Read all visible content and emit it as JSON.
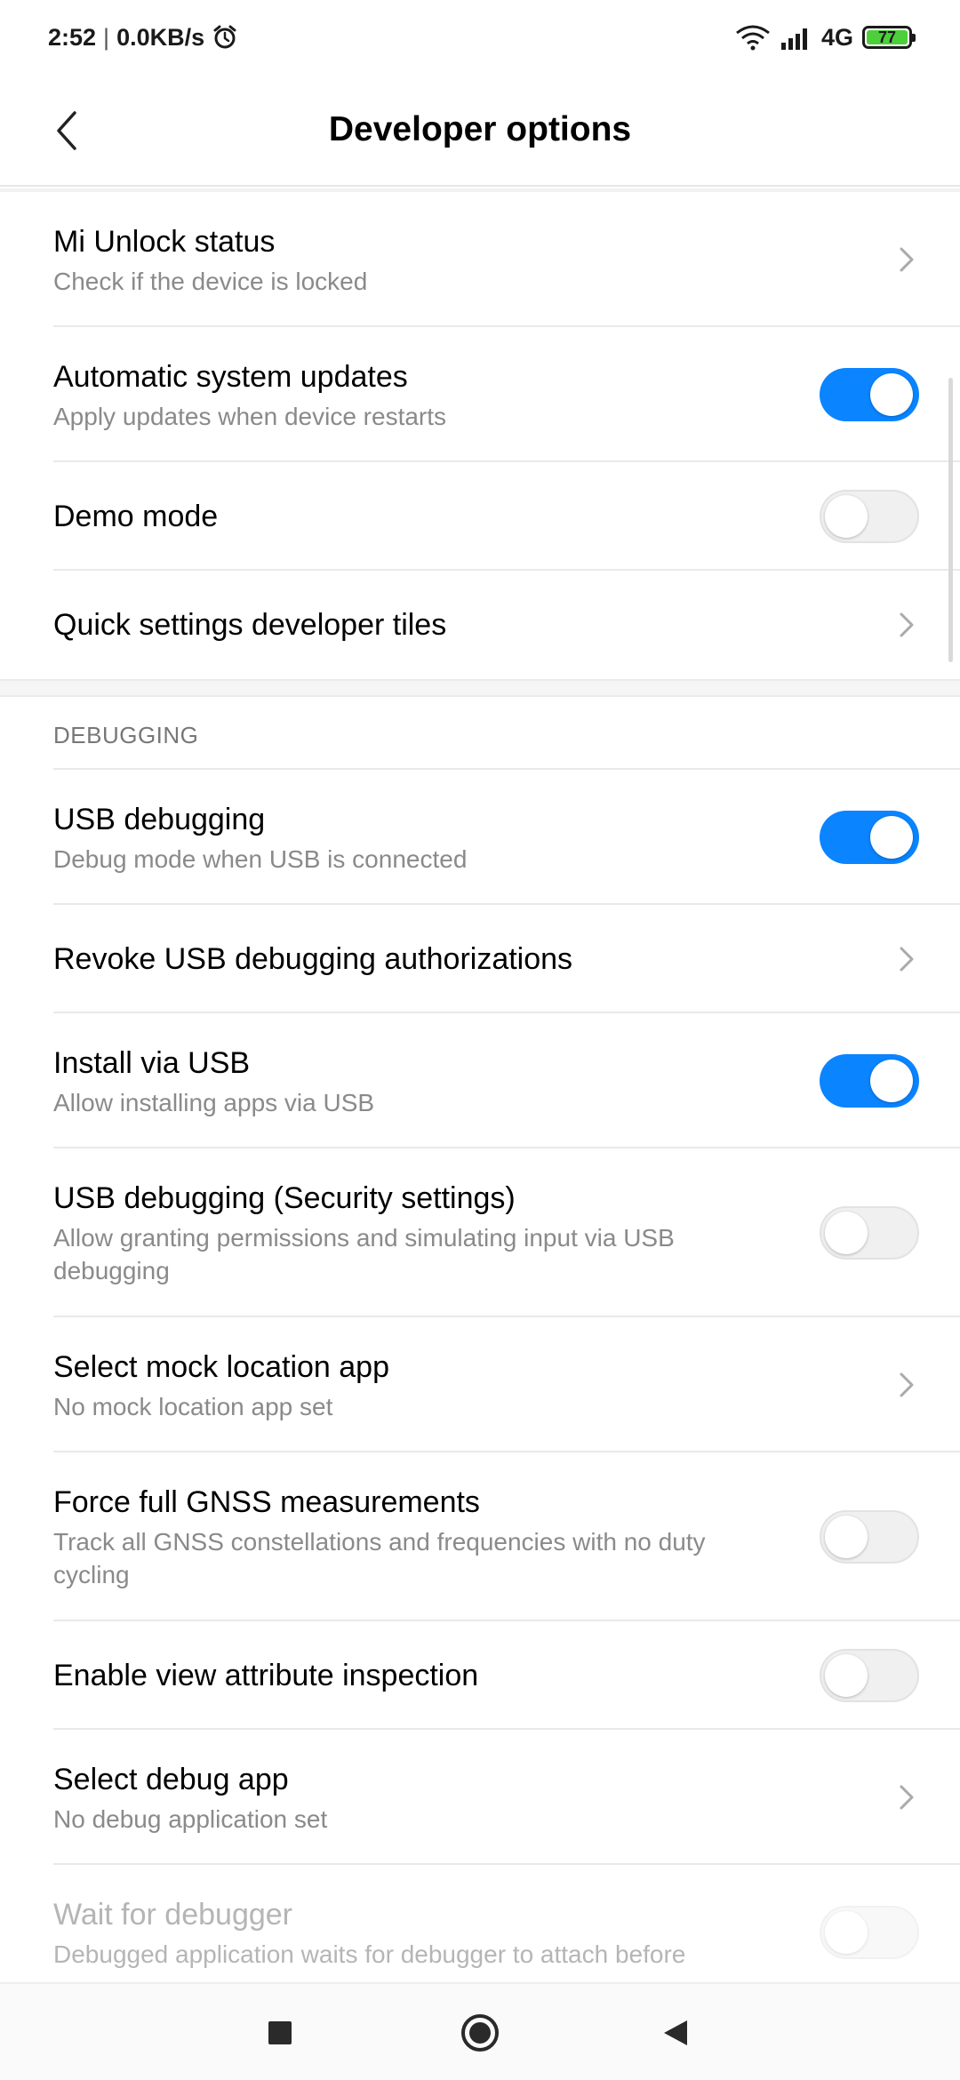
{
  "status_bar": {
    "time": "2:52",
    "speed": "0.0KB/s",
    "network": "4G",
    "battery": "77"
  },
  "header": {
    "title": "Developer options"
  },
  "items": [
    {
      "title": "Mi Unlock status",
      "subtitle": "Check if the device is locked",
      "control": "chevron"
    },
    {
      "title": "Automatic system updates",
      "subtitle": "Apply updates when device restarts",
      "control": "toggle",
      "on": true
    },
    {
      "title": "Demo mode",
      "subtitle": "",
      "control": "toggle",
      "on": false
    },
    {
      "title": "Quick settings developer tiles",
      "subtitle": "",
      "control": "chevron"
    }
  ],
  "debugging": {
    "section_label": "DEBUGGING",
    "items": [
      {
        "title": "USB debugging",
        "subtitle": "Debug mode when USB is connected",
        "control": "toggle",
        "on": true
      },
      {
        "title": "Revoke USB debugging authorizations",
        "subtitle": "",
        "control": "chevron"
      },
      {
        "title": "Install via USB",
        "subtitle": "Allow installing apps via USB",
        "control": "toggle",
        "on": true
      },
      {
        "title": "USB debugging (Security settings)",
        "subtitle": "Allow granting permissions and simulating input via USB debugging",
        "control": "toggle",
        "on": false
      },
      {
        "title": "Select mock location app",
        "subtitle": "No mock location app set",
        "control": "chevron"
      },
      {
        "title": "Force full GNSS measurements",
        "subtitle": "Track all GNSS constellations and frequencies with no duty cycling",
        "control": "toggle",
        "on": false
      },
      {
        "title": "Enable view attribute inspection",
        "subtitle": "",
        "control": "toggle",
        "on": false
      },
      {
        "title": "Select debug app",
        "subtitle": "No debug application set",
        "control": "chevron"
      },
      {
        "title": "Wait for debugger",
        "subtitle": "Debugged application waits for debugger to attach before",
        "control": "toggle",
        "on": false,
        "disabled": true
      }
    ]
  },
  "colors": {
    "accent": "#0a84ff",
    "battery": "#4ccf3a"
  },
  "icons": {
    "back": "back-arrow-icon",
    "chevron": "chevron-right-icon",
    "nav_recents": "square-icon",
    "nav_home": "circle-icon",
    "nav_back": "triangle-back-icon"
  }
}
